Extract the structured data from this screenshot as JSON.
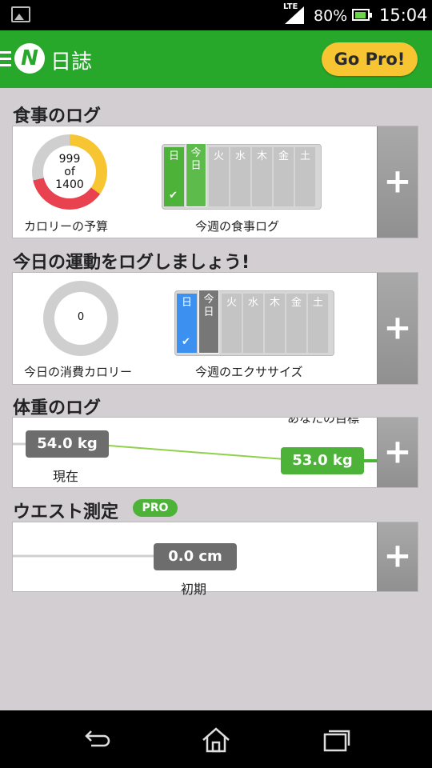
{
  "status_bar": {
    "network": "LTE",
    "battery": "80%",
    "time": "15:04"
  },
  "app_bar": {
    "title": "日誌",
    "logo": "N",
    "go_pro": "Go Pro!"
  },
  "food": {
    "title": "食事のログ",
    "calories_current": "999",
    "calories_of": "of",
    "calories_budget": "1400",
    "budget_caption": "カロリーの予算",
    "week_caption": "今週の食事ログ",
    "days": [
      "日",
      "今日",
      "火",
      "水",
      "木",
      "金",
      "土"
    ],
    "colors": {
      "used": "#f7c531",
      "over": "#e8414f",
      "remaining": "#cfcfcf"
    }
  },
  "exercise": {
    "title": "今日の運動をログしましょう!",
    "burned": "0",
    "burned_caption": "今日の消費カロリー",
    "week_caption": "今週のエクササイズ",
    "days": [
      "日",
      "今日",
      "火",
      "水",
      "木",
      "金",
      "土"
    ]
  },
  "weight": {
    "title": "体重のログ",
    "current_value": "54.0 kg",
    "current_label": "現在",
    "goal_label": "あなたの目標",
    "goal_value": "53.0 kg"
  },
  "waist": {
    "title": "ウエスト測定",
    "badge": "PRO",
    "initial_value": "0.0 cm",
    "initial_label": "初期"
  },
  "plus_label": "+",
  "accent": "#27a82b"
}
